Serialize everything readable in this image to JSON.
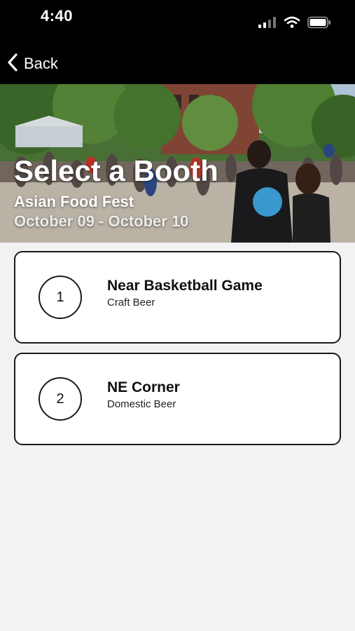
{
  "status_bar": {
    "time": "4:40",
    "icons": [
      "cellular-signal-icon",
      "wifi-icon",
      "battery-icon"
    ]
  },
  "nav": {
    "back_label": "Back"
  },
  "hero": {
    "title": "Select a Booth",
    "event_name": "Asian Food Fest",
    "dates": "October 09 - October 10"
  },
  "booths": [
    {
      "number": "1",
      "name": "Near Basketball Game",
      "description": "Craft Beer"
    },
    {
      "number": "2",
      "name": "NE Corner",
      "description": "Domestic Beer"
    }
  ],
  "colors": {
    "background": "#f2f2f2",
    "top_bar": "#000000",
    "card_border": "#1a1a1a",
    "card_background": "#ffffff"
  }
}
